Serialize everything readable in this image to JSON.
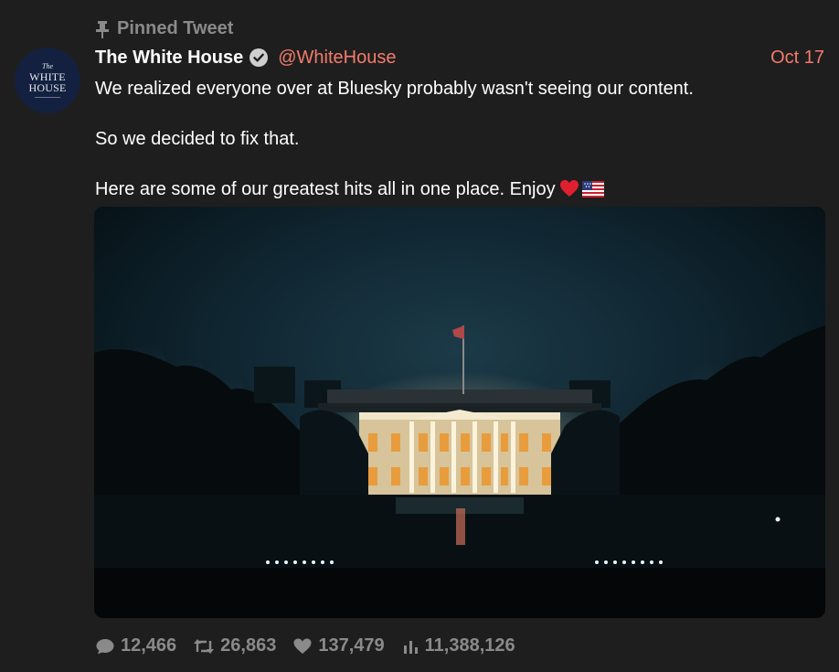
{
  "pinned": {
    "label": "Pinned Tweet",
    "icon": "pin-icon"
  },
  "author": {
    "name": "The White House",
    "handle": "@WhiteHouse",
    "verified_icon": "verified-badge-icon",
    "avatar": {
      "line1": "The",
      "line2": "WHITE",
      "line3": "HOUSE"
    }
  },
  "date": "Oct 17",
  "content": {
    "paragraphs": [
      "We realized everyone over at Bluesky probably wasn't seeing our content.",
      "So we decided to fix that.",
      "Here are some of our greatest hits all in one place. Enjoy"
    ],
    "emojis": [
      "heart-emoji",
      "us-flag-emoji"
    ]
  },
  "stats": {
    "replies": "12,466",
    "retweets": "26,863",
    "likes": "137,479",
    "views": "11,388,126"
  },
  "colors": {
    "background": "#1e1e1e",
    "accent": "#f47b6b",
    "muted": "#8a8a8a"
  }
}
